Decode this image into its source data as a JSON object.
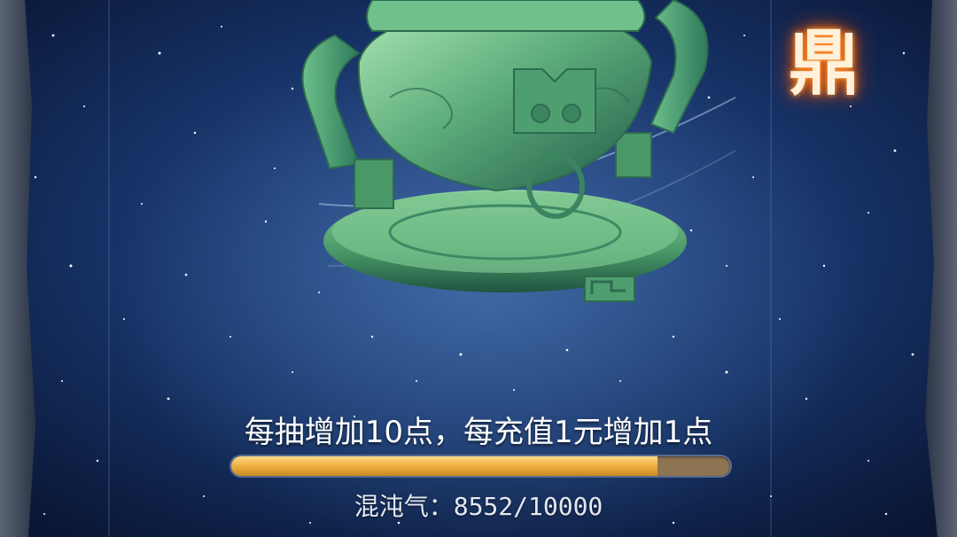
{
  "title_glyph": "鼎",
  "progress": {
    "hint": "每抽增加10点，每充值1元增加1点",
    "label": "混沌气：",
    "current": 8552,
    "max": 10000,
    "value_text": "8552/10000",
    "fill_color": "#f0b443",
    "track_color": "#8d7453"
  },
  "colors": {
    "background": "#0f1f45",
    "cauldron_jade": "#5fae7c"
  }
}
